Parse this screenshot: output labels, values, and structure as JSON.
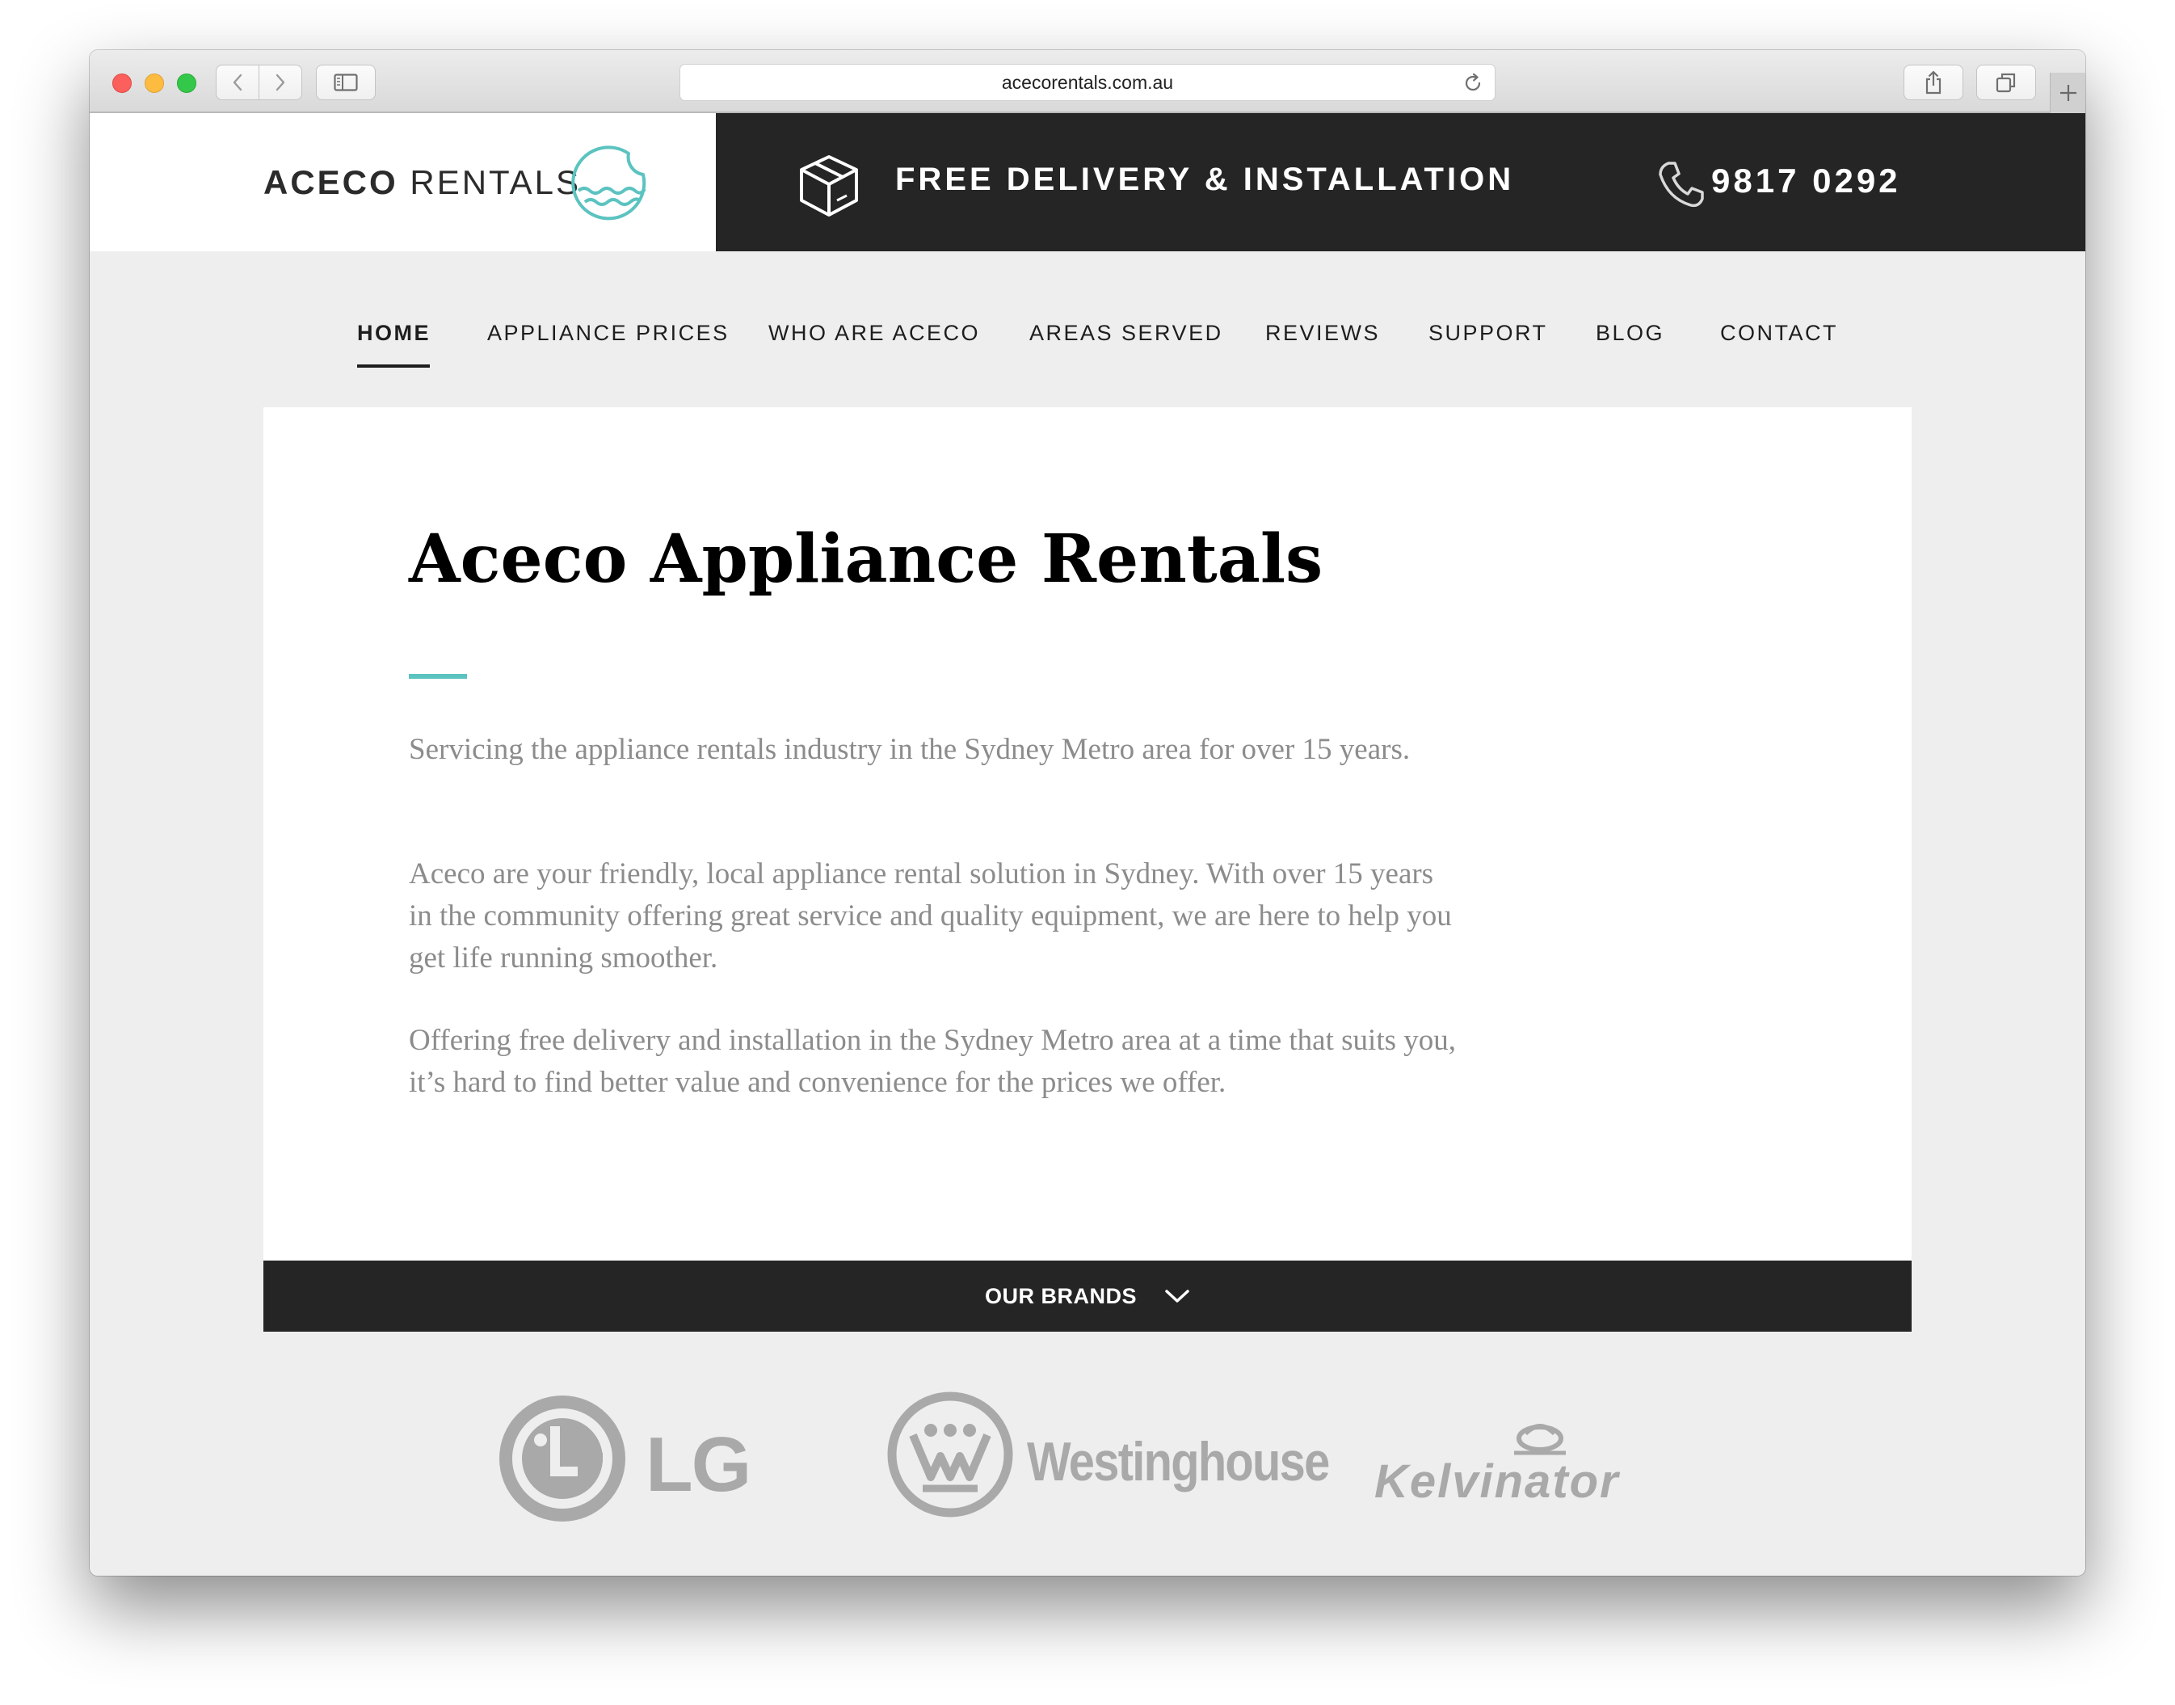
{
  "browser": {
    "url": "acecorentals.com.au",
    "icons": [
      "back-icon",
      "forward-icon",
      "sidebar-icon",
      "reload-icon",
      "share-icon",
      "tabs-icon",
      "plus-icon"
    ]
  },
  "header": {
    "logo": {
      "bold": "ACECO",
      "light": "RENTALS"
    },
    "promo_text": "FREE DELIVERY & INSTALLATION",
    "phone": "9817 0292",
    "accent_color": "#5bc3c0",
    "bar_color": "#252525"
  },
  "nav": {
    "items": [
      {
        "label": "HOME",
        "active": true
      },
      {
        "label": "APPLIANCE PRICES",
        "active": false
      },
      {
        "label": "WHO ARE ACECO",
        "active": false
      },
      {
        "label": "AREAS SERVED",
        "active": false
      },
      {
        "label": "REVIEWS",
        "active": false
      },
      {
        "label": "SUPPORT",
        "active": false
      },
      {
        "label": "BLOG",
        "active": false
      },
      {
        "label": "CONTACT",
        "active": false
      }
    ]
  },
  "main": {
    "title": "Aceco Appliance Rentals",
    "paragraphs": [
      "Servicing the appliance rentals industry in the Sydney Metro area for over 15 years.",
      "Aceco are your friendly, local appliance rental solution in Sydney. With over 15 years in the community offering great service and quality equipment, we are here to help you get life running smoother.",
      "Offering free delivery and installation in the Sydney Metro area at a time that suits you, it’s hard to find better value and convenience for the prices we offer."
    ]
  },
  "brands": {
    "label": "OUR BRANDS",
    "logos": [
      "LG",
      "Westinghouse",
      "Kelvinator"
    ]
  }
}
